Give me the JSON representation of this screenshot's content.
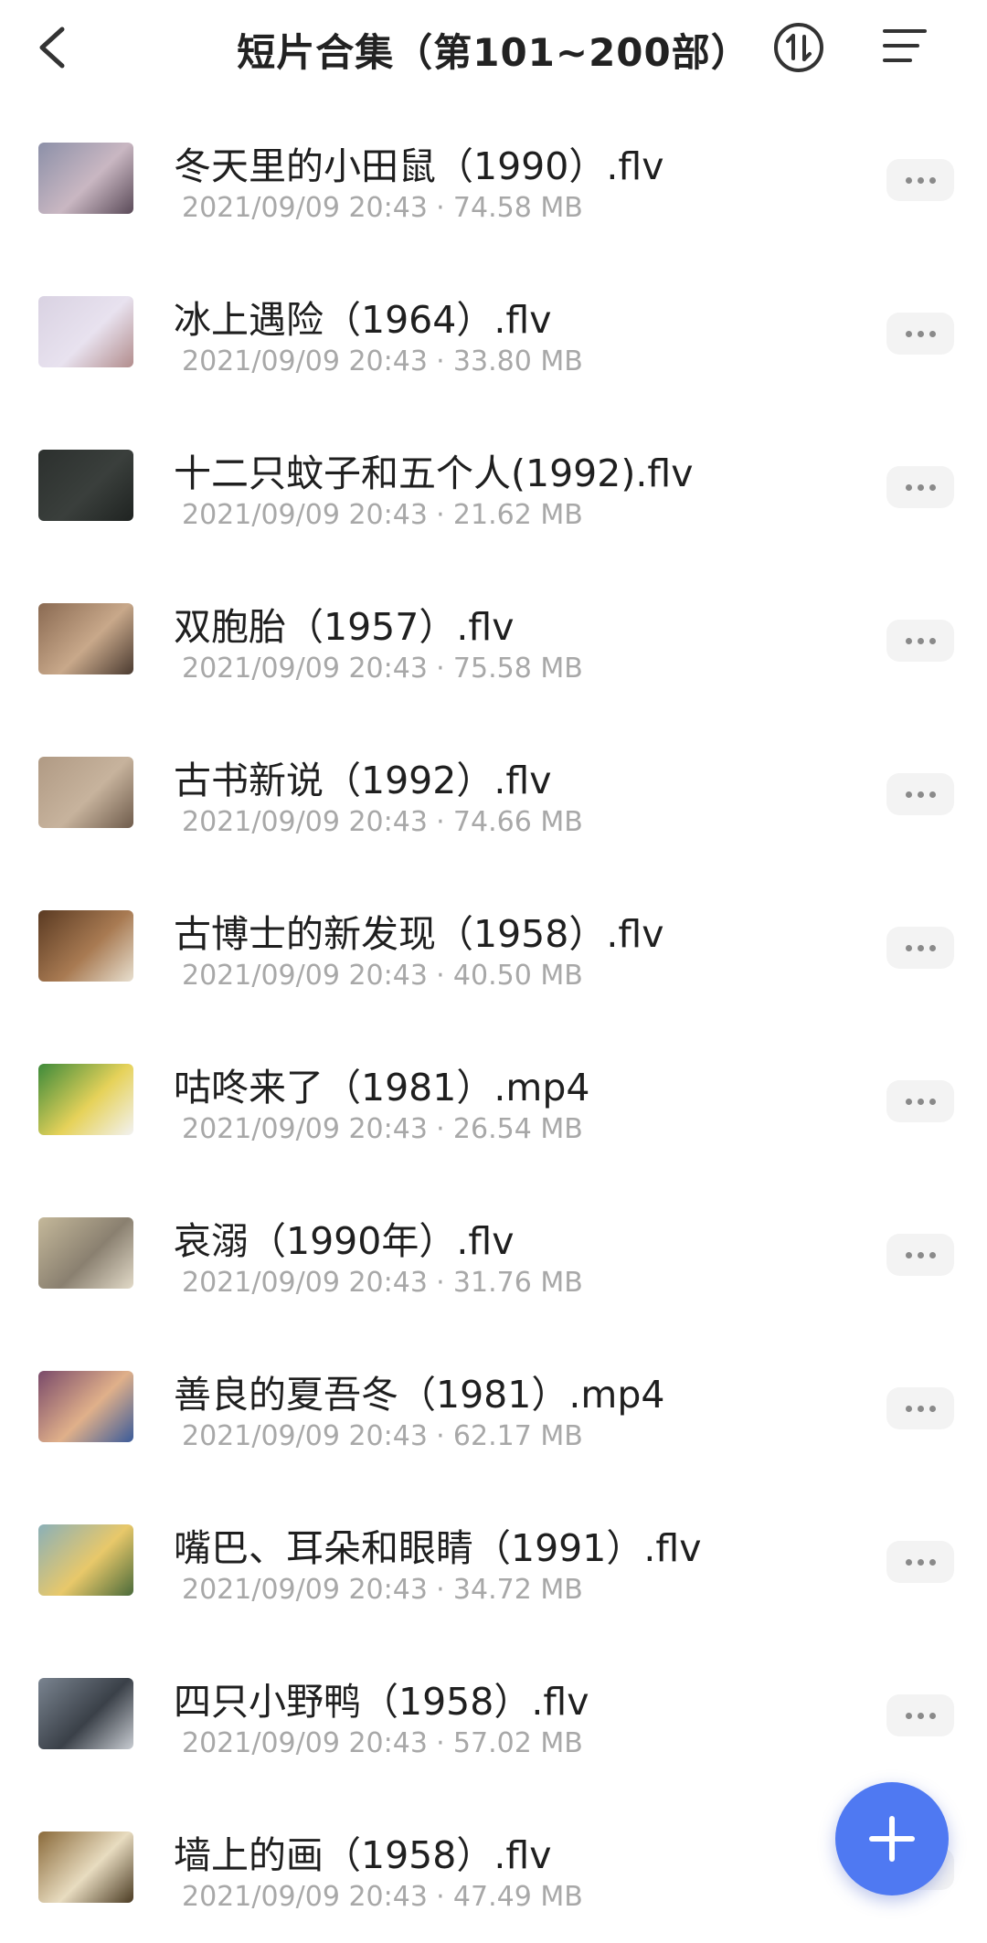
{
  "header": {
    "title": "短片合集（第101~200部）",
    "icons": {
      "back": "chevron-left-icon",
      "sort": "sort-icon",
      "menu": "list-menu-icon"
    }
  },
  "files": [
    {
      "name": "冬天里的小田鼠（1990）.flv",
      "date": "2021/09/09 20:43",
      "size": "74.58 MB",
      "thumb_colors": [
        "#8c90a8",
        "#c9b7c2",
        "#5a4a58"
      ]
    },
    {
      "name": "冰上遇险（1964）.flv",
      "date": "2021/09/09 20:43",
      "size": "33.80 MB",
      "thumb_colors": [
        "#d9d2e2",
        "#e8e2ef",
        "#b28c8c"
      ]
    },
    {
      "name": "十二只蚊子和五个人(1992).flv",
      "date": "2021/09/09 20:43",
      "size": "21.62 MB",
      "thumb_colors": [
        "#2c302e",
        "#3a3f3c",
        "#1f2321"
      ]
    },
    {
      "name": "双胞胎（1957）.flv",
      "date": "2021/09/09 20:43",
      "size": "75.58 MB",
      "thumb_colors": [
        "#8a6a52",
        "#c8a88a",
        "#4a3a30"
      ]
    },
    {
      "name": "古书新说（1992）.flv",
      "date": "2021/09/09 20:43",
      "size": "74.66 MB",
      "thumb_colors": [
        "#b09a84",
        "#c7b39d",
        "#6e5b4b"
      ]
    },
    {
      "name": "古博士的新发现（1958）.flv",
      "date": "2021/09/09 20:43",
      "size": "40.50 MB",
      "thumb_colors": [
        "#5a3a22",
        "#a87a52",
        "#e8e0d0"
      ]
    },
    {
      "name": "咕咚来了（1981）.mp4",
      "date": "2021/09/09 20:43",
      "size": "26.54 MB",
      "thumb_colors": [
        "#3d8a3a",
        "#e6d25a",
        "#f2f2f2"
      ]
    },
    {
      "name": "哀溺（1990年）.flv",
      "date": "2021/09/09 20:43",
      "size": "31.76 MB",
      "thumb_colors": [
        "#c4b89a",
        "#8a8070",
        "#e2dac8"
      ]
    },
    {
      "name": "善良的夏吾冬（1981）.mp4",
      "date": "2021/09/09 20:43",
      "size": "62.17 MB",
      "thumb_colors": [
        "#7a4a6a",
        "#e0b08a",
        "#3a5a9a"
      ]
    },
    {
      "name": "嘴巴、耳朵和眼睛（1991）.flv",
      "date": "2021/09/09 20:43",
      "size": "34.72 MB",
      "thumb_colors": [
        "#8ab0b8",
        "#e8c86a",
        "#4a6a3a"
      ]
    },
    {
      "name": "四只小野鸭（1958）.flv",
      "date": "2021/09/09 20:43",
      "size": "57.02 MB",
      "thumb_colors": [
        "#7a8490",
        "#3a4048",
        "#c8ccd2"
      ]
    },
    {
      "name": "墙上的画（1958）.flv",
      "date": "2021/09/09 20:43",
      "size": "47.49 MB",
      "thumb_colors": [
        "#8a6a3a",
        "#e8dcc0",
        "#4a3a22"
      ]
    }
  ],
  "more_icon": "more-dots-icon",
  "fab": {
    "icon": "plus-icon",
    "color": "#4f79f2"
  },
  "colors": {
    "title": "#222222",
    "meta": "#a8a8a8",
    "accent": "#4f79f2"
  }
}
